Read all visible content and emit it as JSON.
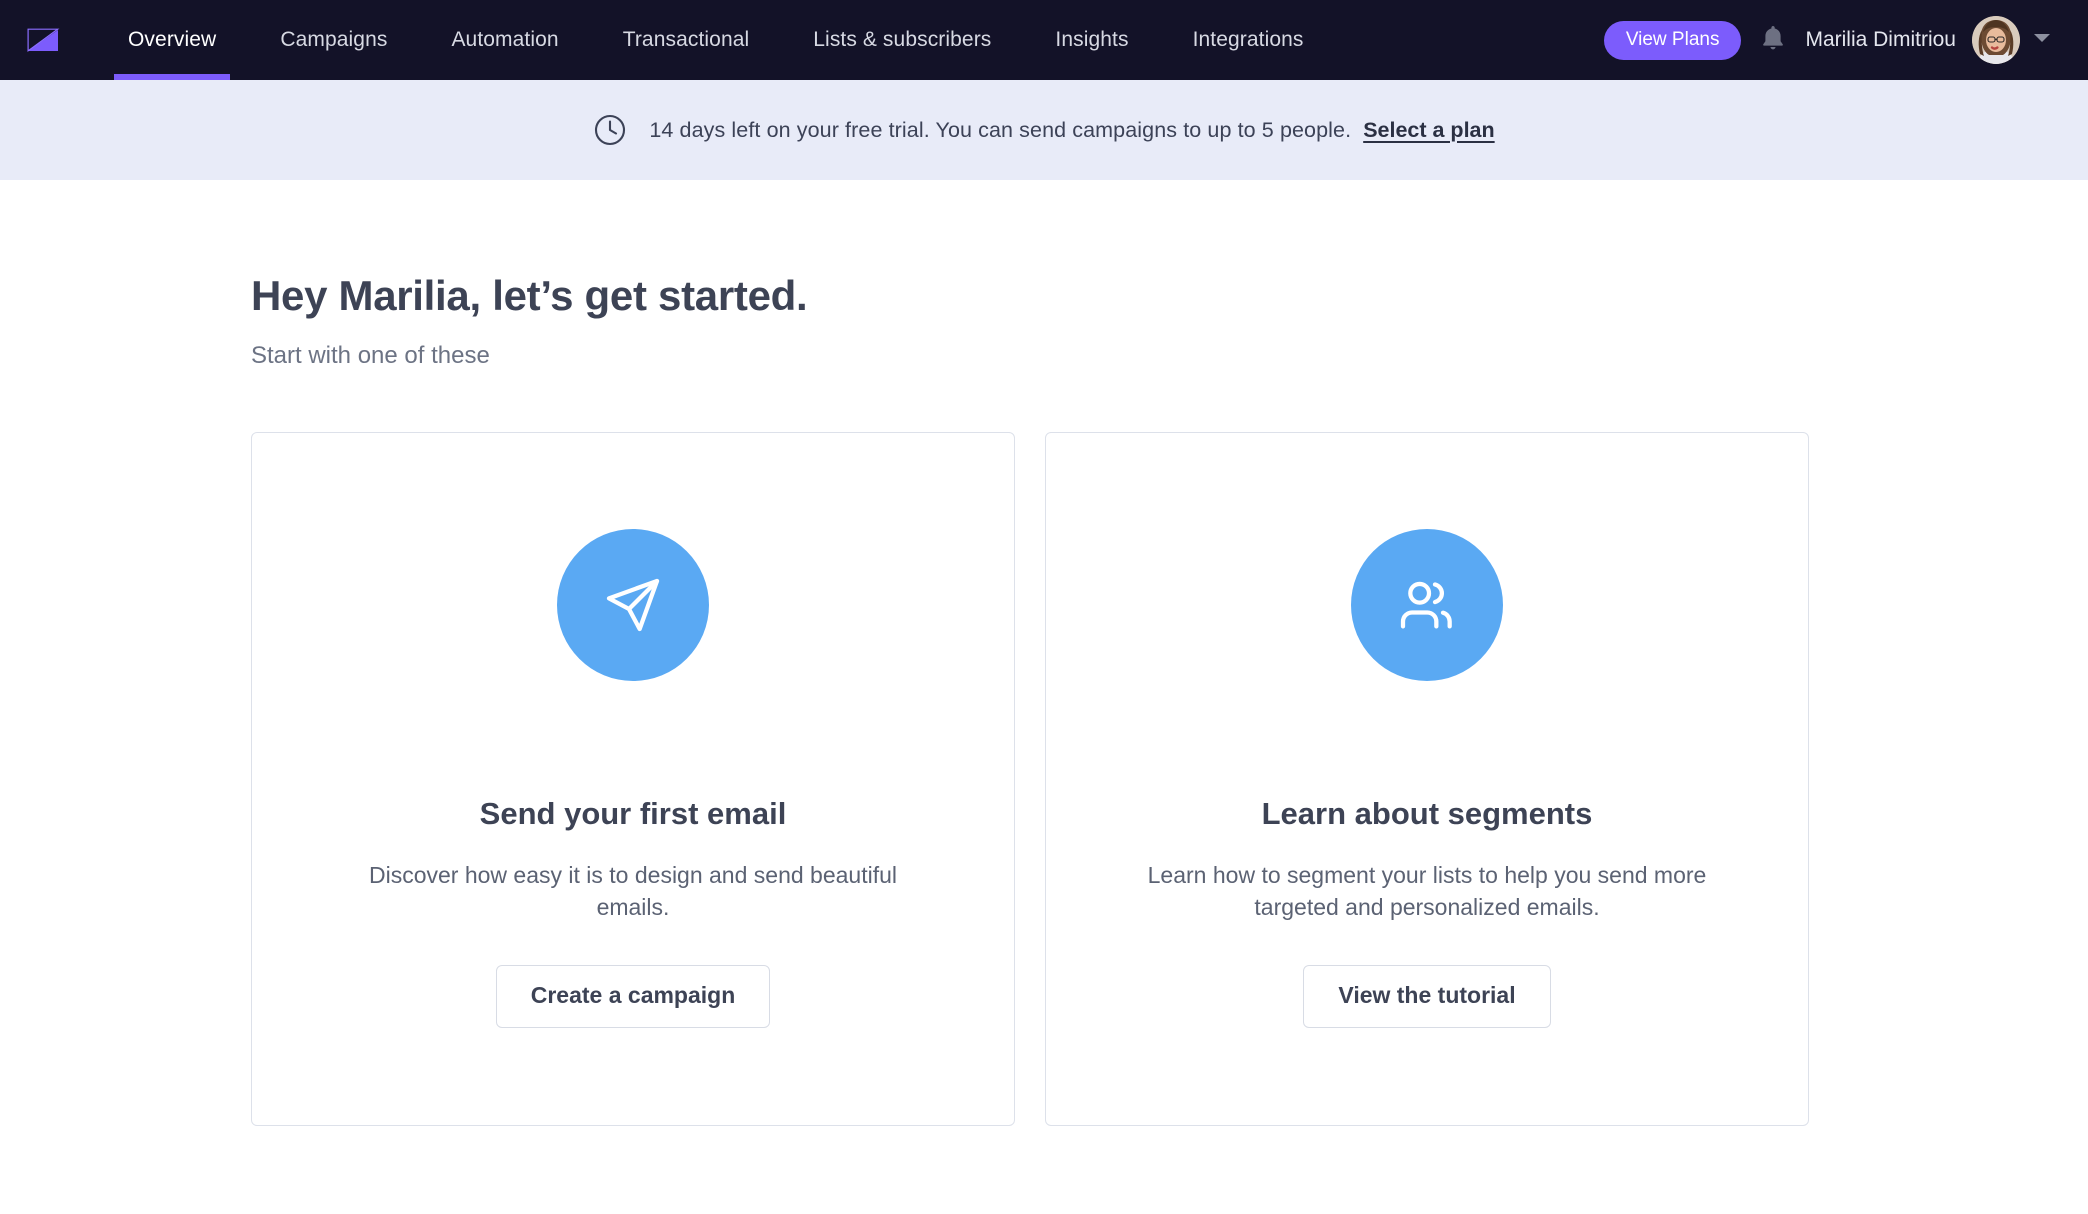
{
  "navbar": {
    "logo_icon": "mailerlite-envelope-logo",
    "tabs": [
      {
        "label": "Overview",
        "active": true
      },
      {
        "label": "Campaigns",
        "active": false
      },
      {
        "label": "Automation",
        "active": false
      },
      {
        "label": "Transactional",
        "active": false
      },
      {
        "label": "Lists & subscribers",
        "active": false
      },
      {
        "label": "Insights",
        "active": false
      },
      {
        "label": "Integrations",
        "active": false
      }
    ],
    "view_plans_label": "View Plans",
    "notifications_icon": "bell-icon",
    "user_name": "Marilia Dimitriou",
    "avatar_icon": "user-avatar-photo",
    "dropdown_icon": "chevron-down-icon",
    "background_color": "#131228",
    "accent_color": "#7c5cfc"
  },
  "banner": {
    "icon": "clock-icon",
    "text": "14 days left on your free trial. You can send campaigns to up to 5 people.",
    "link_label": "Select a plan",
    "background_color": "#e8ebf8"
  },
  "main": {
    "title": "Hey Marilia, let’s get started.",
    "subtitle": "Start with one of these",
    "cards": [
      {
        "icon": "send-paper-plane-icon",
        "icon_color": "#5aa9f3",
        "title": "Send your first email",
        "description": "Discover how easy it is to design and send beautiful emails.",
        "button_label": "Create a campaign"
      },
      {
        "icon": "users-icon",
        "icon_color": "#5aa9f3",
        "title": "Learn about segments",
        "description": "Learn how to segment your lists to help you send more targeted and personalized emails.",
        "button_label": "View the tutorial"
      }
    ]
  }
}
